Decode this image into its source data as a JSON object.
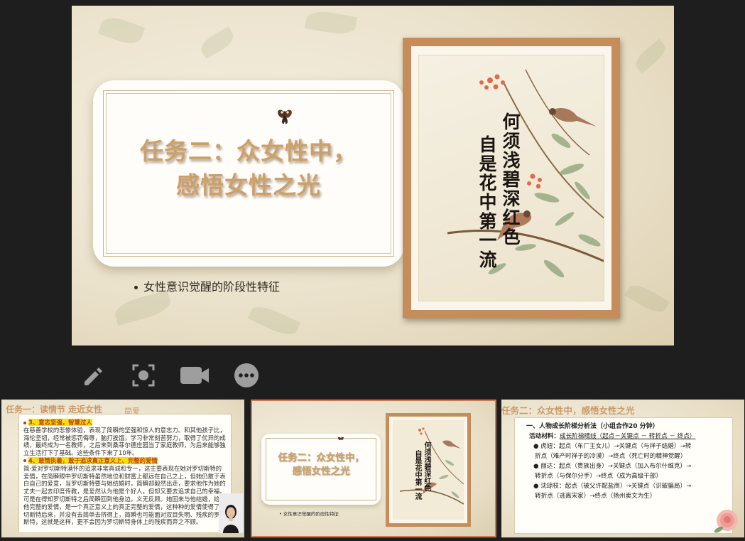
{
  "slide": {
    "title_line1": "任务二：众女性中，",
    "title_line2": "感悟女性之光",
    "subtitle": "女性意识觉醒的阶段性特征",
    "poem_col1": "何须浅碧深红色",
    "poem_col2": "自是花中第一流"
  },
  "toolbar": {
    "icons": [
      "pencil-icon",
      "camera-focus-icon",
      "video-camera-icon",
      "more-options-icon"
    ]
  },
  "thumbnails": {
    "t1": {
      "header": "任务一：读情节 走近女性",
      "header2": "简爱",
      "point3": "3、意志坚强，智慧过人",
      "text3": "在慈善学校的悲惨体验，表现了简瞬的坚强和惊人的意志力。和其他孩子比，海伦坚韧，经常被惩罚侮辱，脑打挨饿，学习非常刻苦努力，取得了优异的成绩，最终成为一名教师，之后来到桑菲尔德庄园当了家庭教师，为后来能够独立生活打下了基础。这些条件下来了10年。",
      "point4": "4、敢情执着，敢于追求真正意义上、完整的爱情",
      "text4": "简·爱对罗切斯特满怀的追求非常真诚和专一，这主要表现在她对罗切斯特的爱情，在简瞬眼中罗切斯特虽然地位和财富上都远在自己之上，但她仍敢于表白自己的爱意，当罗切斯特要与她结婚时，简瞬却毅然出走，要求他作为她的丈夫一起去印度传教，是爱然认为他是个好人，但却又要去追求自己的幸福。可是在得知罗切斯特之后简瞬回到他身边，义无反顾。她回来与他结婚，给予他完整的爱情，是一个真正意义上的真正完整的爱情，这种种的爱情使得了罗切斯特后来，并没有去简单去挤得上，简瞬也可能面对双目失明、残疾的罗切斯特，这就是这样，更不会因为罗切斯特身体上的残疾而弃之不顾。"
    },
    "t2": {
      "title_line1": "任务二：众女性中，",
      "title_line2": "感悟女性之光",
      "subtitle": "女性意识觉醒的阶段性特征",
      "poem_col1": "何须浅碧深红色",
      "poem_col2": "自是花中第一流"
    },
    "t3": {
      "header": "任务二：众女性中，感悟女性之光",
      "heading": "一、人物成长阶梯分析法（小组合作20 分钟）",
      "material_label": "活动材料：",
      "material_value": "成长阶梯晴线（起点－关键点 － 转折点 － 终点）",
      "item1_a": "虎妞：起点（车厂主女儿）→关键点（与祥子结婚）→转",
      "item1_b": "折点（难产时祥子的冷漠）→终点（死亡时的精神觉醒）",
      "item2_a": "丽达：起点（贵族出身）→关键点（加入布尔什维克）→",
      "item2_b": "转折点（与保尔分手）→终点（成为高级干部）",
      "item3_a": "沈琼枝：起点（被父许配盐商）→关键点（识破骗局）→",
      "item3_b": "转折点（逃离宋家）→终点（扬州卖文为生）"
    }
  },
  "colors": {
    "title": "#cba06a",
    "frame": "#c58d5a",
    "background": "#1e1e1e",
    "highlight": "#f5e200",
    "accent_red": "#c0391b"
  }
}
